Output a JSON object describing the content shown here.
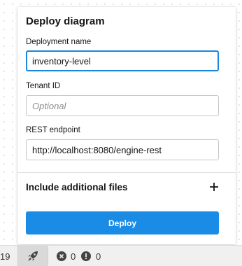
{
  "popup": {
    "title": "Deploy diagram",
    "fields": [
      {
        "label": "Deployment name",
        "value": "inventory-level",
        "placeholder": ""
      },
      {
        "label": "Tenant ID",
        "value": "",
        "placeholder": "Optional"
      },
      {
        "label": "REST endpoint",
        "value": "http://localhost:8080/engine-rest",
        "placeholder": ""
      }
    ],
    "additional_files_label": "Include additional files",
    "deploy_label": "Deploy"
  },
  "status_bar": {
    "left_number": "19",
    "errors": "0",
    "warnings": "0"
  },
  "icons": {
    "plus": "plus-icon",
    "rocket": "rocket-icon",
    "error": "error-icon",
    "warning": "warning-icon"
  },
  "colors": {
    "accent": "#1a8ce6",
    "focus_border": "#1a86de"
  }
}
